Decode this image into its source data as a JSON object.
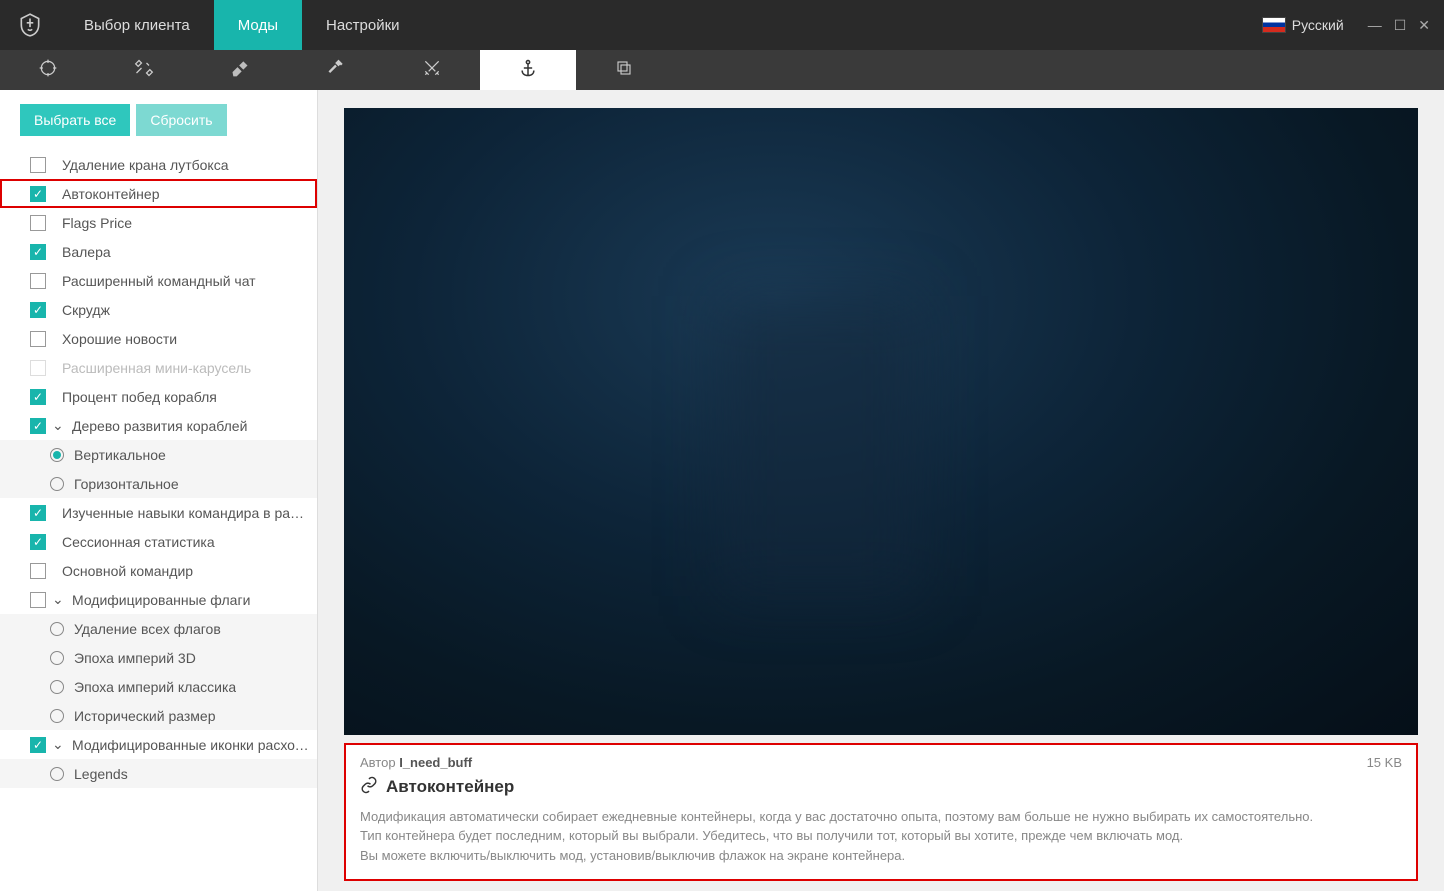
{
  "titlebar": {
    "nav": [
      "Выбор клиента",
      "Моды",
      "Настройки"
    ],
    "active_nav": 1,
    "language": "Русский"
  },
  "tabbar": {
    "icons": [
      "crosshair",
      "tools",
      "eraser",
      "hammer",
      "swords",
      "anchor",
      "copy"
    ],
    "active": 5
  },
  "sidebar": {
    "select_all": "Выбрать все",
    "reset": "Сбросить",
    "items": [
      {
        "type": "check",
        "checked": false,
        "label": "Удаление крана лутбокса"
      },
      {
        "type": "check",
        "checked": true,
        "label": "Автоконтейнер",
        "selected": true
      },
      {
        "type": "check",
        "checked": false,
        "label": "Flags Price"
      },
      {
        "type": "check",
        "checked": true,
        "label": "Валера"
      },
      {
        "type": "check",
        "checked": false,
        "label": "Расширенный командный чат"
      },
      {
        "type": "check",
        "checked": true,
        "label": "Скрудж"
      },
      {
        "type": "check",
        "checked": false,
        "label": "Хорошие новости"
      },
      {
        "type": "check",
        "checked": false,
        "label": "Расширенная мини-карусель",
        "disabled": true
      },
      {
        "type": "check",
        "checked": true,
        "label": "Процент побед корабля"
      },
      {
        "type": "check",
        "checked": true,
        "label": "Дерево развития кораблей",
        "expandable": true,
        "expanded": true
      },
      {
        "type": "radio",
        "checked": true,
        "label": "Вертикальное"
      },
      {
        "type": "radio",
        "checked": false,
        "label": "Горизонтальное"
      },
      {
        "type": "check",
        "checked": true,
        "label": "Изученные навыки командира в ранговых боях"
      },
      {
        "type": "check",
        "checked": true,
        "label": "Сессионная статистика"
      },
      {
        "type": "check",
        "checked": false,
        "label": "Основной командир"
      },
      {
        "type": "check",
        "checked": false,
        "label": "Модифицированные флаги",
        "expandable": true,
        "expanded": true
      },
      {
        "type": "radio",
        "checked": false,
        "label": "Удаление всех флагов"
      },
      {
        "type": "radio",
        "checked": false,
        "label": "Эпоха империй 3D"
      },
      {
        "type": "radio",
        "checked": false,
        "label": "Эпоха империй классика"
      },
      {
        "type": "radio",
        "checked": false,
        "label": "Исторический размер"
      },
      {
        "type": "check",
        "checked": true,
        "label": "Модифицированные иконки расходников",
        "expandable": true,
        "expanded": true
      },
      {
        "type": "radio",
        "checked": false,
        "label": "Legends"
      }
    ]
  },
  "detail": {
    "author_label": "Автор",
    "author": "I_need_buff",
    "size": "15 KB",
    "title": "Автоконтейнер",
    "description": "Модификация автоматически собирает ежедневные контейнеры, когда у вас достаточно опыта, поэтому вам больше не нужно выбирать их самостоятельно.\nТип контейнера будет последним, который вы выбрали. Убедитесь, что вы получили тот, который вы хотите, прежде чем включать мод.\nВы можете включить/выключить мод, установив/выключив флажок на экране контейнера."
  }
}
